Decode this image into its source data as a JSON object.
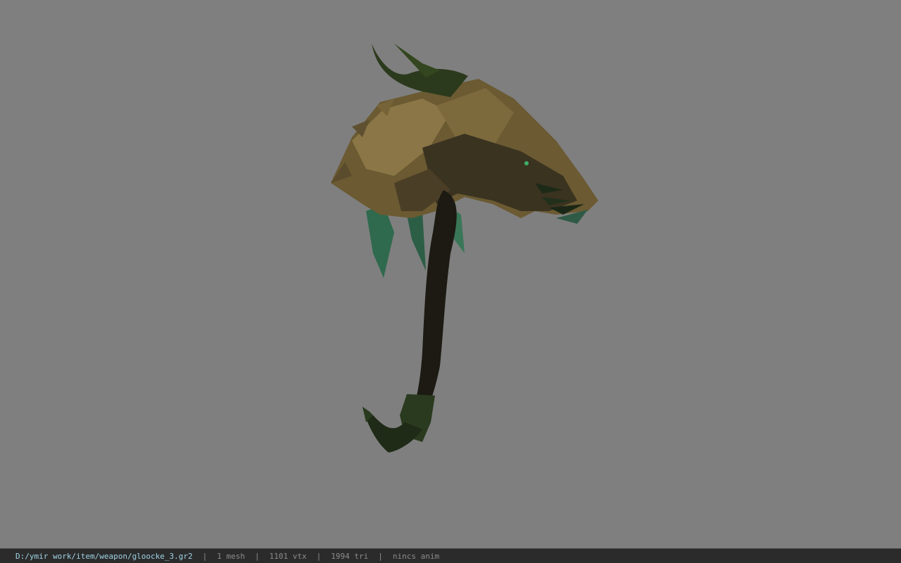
{
  "viewport": {
    "background_color": "#7f7f7f",
    "model": {
      "description_icon": "scythe-model",
      "colors": {
        "blade": "#6b5a32",
        "blade_light": "#8a7646",
        "blade_dark": "#3a3320",
        "handle": "#1c1a12",
        "horn": "#2b3a1c",
        "glow": "#2f6a4e"
      }
    }
  },
  "statusbar": {
    "path": "D:/ymir work/item/weapon/gloocke_3.gr2",
    "separator": "|",
    "mesh": "1 mesh",
    "vtx": "1101 vtx",
    "tri": "1994 tri",
    "anim": "nincs anim",
    "path_color": "#9fd3e6",
    "text_color": "#8c8c8c"
  }
}
